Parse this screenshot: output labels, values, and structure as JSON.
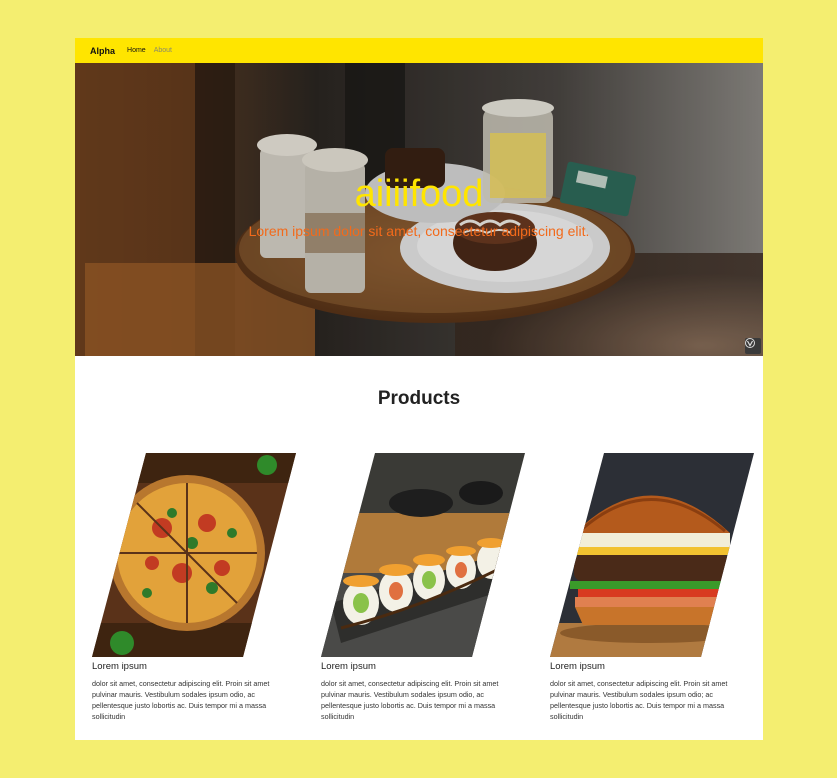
{
  "navbar": {
    "brand": "Alpha",
    "links": [
      {
        "label": "Home"
      },
      {
        "label": "About"
      }
    ]
  },
  "hero": {
    "title": "aiiiifood",
    "subtitle": "Lorem ipsum dolor sit amet, consectetur adipiscing elit."
  },
  "products": {
    "heading": "Products",
    "items": [
      {
        "image": "pizza",
        "title": "Lorem ipsum",
        "text": "dolor sit amet, consectetur adipiscing elit. Proin sit amet pulvinar mauris. Vestibulum sodales ipsum odio, ac pellentesque justo lobortis ac. Duis tempor mi a massa sollicitudin"
      },
      {
        "image": "sushi",
        "title": "Lorem ipsum",
        "text": "dolor sit amet, consectetur adipiscing elit. Proin sit amet pulvinar mauris. Vestibulum sodales ipsum odio, ac pellentesque justo lobortis ac. Duis tempor mi a massa sollicitudin"
      },
      {
        "image": "burger",
        "title": "Lorem ipsum",
        "text": "dolor sit amet, consectetur adipiscing elit. Proin sit amet pulvinar mauris. Vestibulum sodales ipsum odio; ac pellentesque justo lobortis ac. Duis tempor mi a massa sollicitudin"
      }
    ]
  },
  "colors": {
    "background": "#f4ee70",
    "navbar": "#ffe500",
    "hero_title": "#ffe500",
    "hero_subtitle": "#f26a1b"
  }
}
